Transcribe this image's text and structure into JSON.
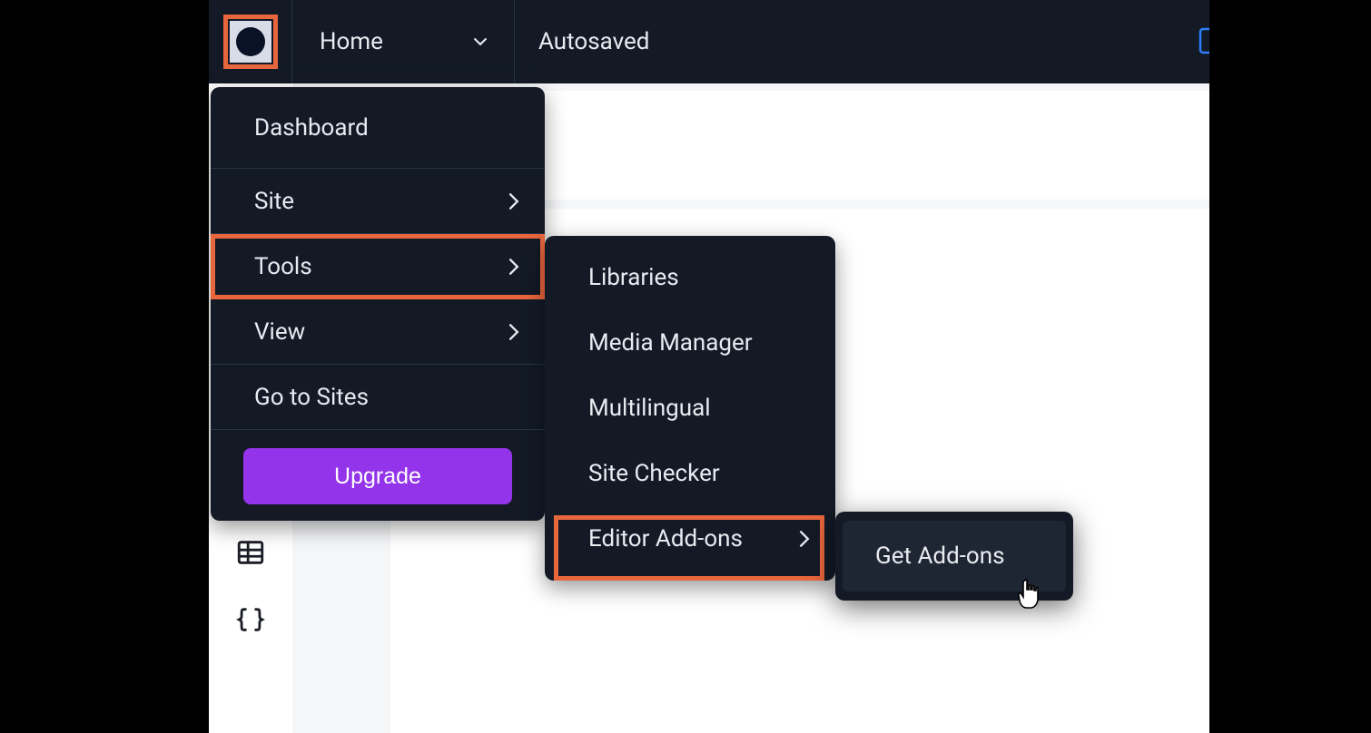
{
  "topbar": {
    "page_label": "Home",
    "status": "Autosaved"
  },
  "main_menu": {
    "items": [
      {
        "label": "Dashboard",
        "has_submenu": false
      },
      {
        "label": "Site",
        "has_submenu": true
      },
      {
        "label": "Tools",
        "has_submenu": true,
        "highlighted": true
      },
      {
        "label": "View",
        "has_submenu": true
      },
      {
        "label": "Go to Sites",
        "has_submenu": false
      }
    ],
    "upgrade_label": "Upgrade"
  },
  "tools_submenu": {
    "items": [
      {
        "label": "Libraries",
        "has_submenu": false
      },
      {
        "label": "Media Manager",
        "has_submenu": false
      },
      {
        "label": "Multilingual",
        "has_submenu": false
      },
      {
        "label": "Site Checker",
        "has_submenu": false
      },
      {
        "label": "Editor Add-ons",
        "has_submenu": true,
        "highlighted": true
      }
    ]
  },
  "addons_submenu": {
    "items": [
      {
        "label": "Get Add-ons"
      }
    ]
  },
  "colors": {
    "highlight": "#e8663c",
    "upgrade": "#9333ea",
    "panel_bg": "#131a26"
  }
}
